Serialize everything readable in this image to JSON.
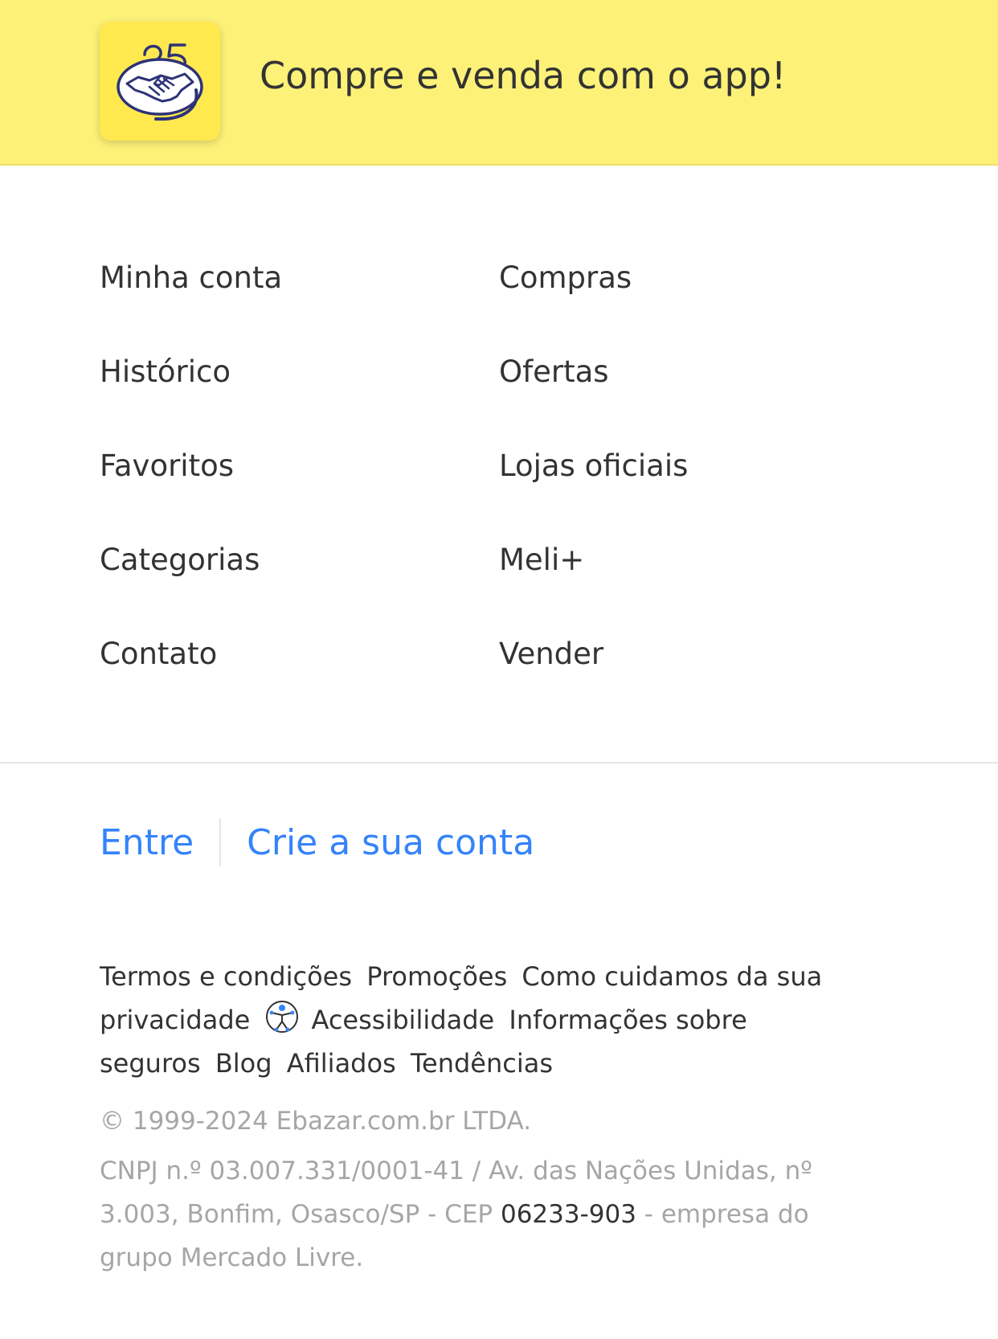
{
  "banner": {
    "title": "Compre e venda com o app!",
    "app_icon": "mercado-livre-handshake-25-logo",
    "background_color": "#fdf178",
    "icon_background_color": "#ffe94f"
  },
  "nav": {
    "items": [
      {
        "label": "Minha conta"
      },
      {
        "label": "Compras"
      },
      {
        "label": "Histórico"
      },
      {
        "label": "Ofertas"
      },
      {
        "label": "Favoritos"
      },
      {
        "label": "Lojas oficiais"
      },
      {
        "label": "Categorias"
      },
      {
        "label": "Meli+"
      },
      {
        "label": "Contato"
      },
      {
        "label": "Vender"
      }
    ]
  },
  "auth": {
    "login_label": "Entre",
    "signup_label": "Crie a sua conta",
    "link_color": "#3483fa"
  },
  "footer": {
    "links": {
      "terms": "Termos e condições",
      "promotions": "Promoções",
      "privacy": "Como cuidamos da sua privacidade",
      "accessibility": "Acessibilidade",
      "insurance": "Informações sobre seguros",
      "blog": "Blog",
      "affiliates": "Afiliados",
      "trends": "Tendências"
    },
    "accessibility_icon": "accessibility-person-icon",
    "copyright": "© 1999-2024 Ebazar.com.br LTDA.",
    "address_prefix": "CNPJ n.º 03.007.331/0001-41 / Av. das Nações Unidas, nº 3.003, Bonfim, Osasco/SP - CEP ",
    "cep": "06233-903",
    "address_suffix": " - empresa do grupo Mercado Livre."
  }
}
